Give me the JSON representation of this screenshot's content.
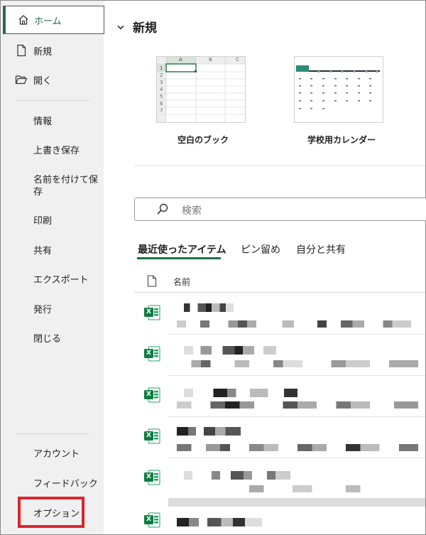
{
  "sidebar": {
    "home": "ホーム",
    "new": "新規",
    "open": "開く",
    "info": "情報",
    "overwrite_save": "上書き保存",
    "save_as": "名前を付けて保存",
    "print": "印刷",
    "share": "共有",
    "export": "エクスポート",
    "publish": "発行",
    "close": "閉じる",
    "account": "アカウント",
    "feedback": "フィードバック",
    "options": "オプション"
  },
  "main": {
    "section_title": "新規",
    "templates": [
      {
        "label": "空白のブック"
      },
      {
        "label": "学校用カレンダー"
      }
    ],
    "blank_sheet": {
      "columns": [
        "A",
        "B",
        "C"
      ],
      "rows": [
        "1",
        "2",
        "3",
        "4",
        "5",
        "6",
        "7"
      ]
    },
    "search_placeholder": "検索",
    "tabs": [
      "最近使ったアイテム",
      "ピン留め",
      "自分と共有"
    ],
    "active_tab": 0,
    "list_header_name": "名前",
    "file_icon_label": "X"
  },
  "colors": {
    "accent": "#1e7145",
    "highlight_box": "#d9262c",
    "sidebar_bg": "#f0f0f0"
  },
  "icons": {
    "home": "home-icon",
    "new": "new-document-icon",
    "open": "folder-open-icon",
    "section_toggle": "chevron-down-icon",
    "search": "search-icon",
    "file_column": "document-icon",
    "excel": "excel-file-icon"
  }
}
